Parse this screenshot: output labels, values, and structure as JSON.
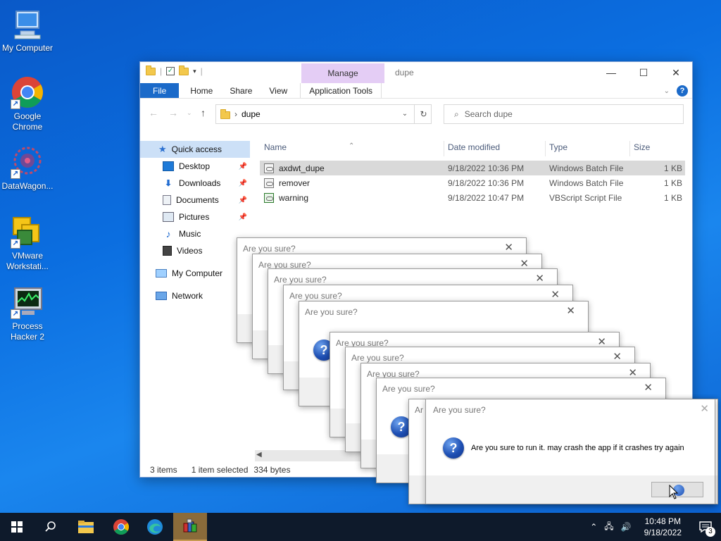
{
  "desktop": {
    "icons": [
      {
        "label": "My Computer",
        "icon": "computer-icon"
      },
      {
        "label": "Google Chrome",
        "icon": "chrome-icon"
      },
      {
        "label": "DataWagon...",
        "icon": "datawagon-icon"
      },
      {
        "label": "VMware Workstati...",
        "icon": "vmware-icon"
      },
      {
        "label": "Process Hacker 2",
        "icon": "process-hacker-icon"
      }
    ]
  },
  "explorer": {
    "title": "dupe",
    "manage_tab": "Manage",
    "ribbon_tabs": [
      "File",
      "Home",
      "Share",
      "View",
      "Application Tools"
    ],
    "address": "dupe",
    "search_placeholder": "Search dupe",
    "nav": {
      "quick_access": "Quick access",
      "items": [
        "Desktop",
        "Downloads",
        "Documents",
        "Pictures",
        "Music",
        "Videos"
      ],
      "my_computer": "My Computer",
      "network": "Network"
    },
    "columns": [
      "Name",
      "Date modified",
      "Type",
      "Size"
    ],
    "files": [
      {
        "name": "axdwt_dupe",
        "date": "9/18/2022 10:36 PM",
        "type": "Windows Batch File",
        "size": "1 KB"
      },
      {
        "name": "remover",
        "date": "9/18/2022 10:36 PM",
        "type": "Windows Batch File",
        "size": "1 KB"
      },
      {
        "name": "warning",
        "date": "9/18/2022 10:47 PM",
        "type": "VBScript Script File",
        "size": "1 KB"
      }
    ],
    "status": {
      "items": "3 items",
      "selected": "1 item selected",
      "size": "334 bytes"
    }
  },
  "dialogs": {
    "title": "Are you sure?",
    "front_title": "Are you sure?",
    "message": "Are you sure to run it. may crash the app if it crashes try again",
    "peek_text": "Ar"
  },
  "taskbar": {
    "time": "10:48 PM",
    "date": "9/18/2022",
    "notification_count": "3"
  },
  "colors": {
    "accent": "#1b6ac9",
    "manage_tab": "#e4cdf5",
    "selection": "#cce0f7"
  }
}
